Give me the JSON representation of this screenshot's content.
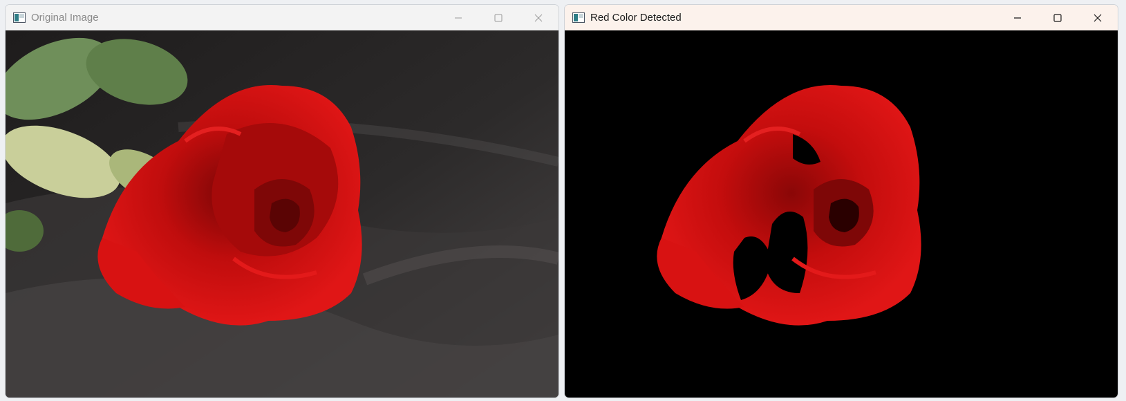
{
  "windows": [
    {
      "title": "Original Image",
      "state": "inactive",
      "icon": "opencv-window-icon",
      "controls": [
        "minimize-icon",
        "maximize-icon",
        "close-icon"
      ]
    },
    {
      "title": "Red Color Detected",
      "state": "active",
      "icon": "opencv-window-icon",
      "controls": [
        "minimize-icon",
        "maximize-icon",
        "close-icon"
      ]
    }
  ],
  "colors": {
    "titlebar_inactive": "#f3f3f3",
    "titlebar_active": "#fcf2ec",
    "rose_red": "#c80d0d",
    "mask_background": "#000000",
    "fabric_dark": "#2d2b2b"
  }
}
